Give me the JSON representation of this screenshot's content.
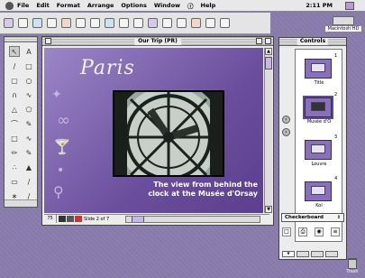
{
  "menubar": {
    "menus": [
      "File",
      "Edit",
      "Format",
      "Arrange",
      "Options",
      "Window",
      "Help"
    ],
    "clock": "2:11 PM"
  },
  "desktop": {
    "drive_label": "Macintosh HD",
    "trash_label": "Trash"
  },
  "window": {
    "title": "Our Trip (PR)",
    "zoom": "75",
    "slide_indicator": "Slide 2 of 7"
  },
  "slide": {
    "title": "Paris",
    "caption_line1": "The view from behind the",
    "caption_line2": "clock at the Musée d'Orsay"
  },
  "controls": {
    "title": "Controls",
    "thumbnails": [
      {
        "number": "1",
        "label": "Title"
      },
      {
        "number": "2",
        "label": "Musée d'O"
      },
      {
        "number": "3",
        "label": "Louvre"
      },
      {
        "number": "4",
        "label": "Koi"
      }
    ],
    "transition": "Checkerboard",
    "selected_slide_index": 2
  },
  "colors": {
    "slide_bg": "#7a5fb0",
    "accent": "#c7b6e8"
  }
}
